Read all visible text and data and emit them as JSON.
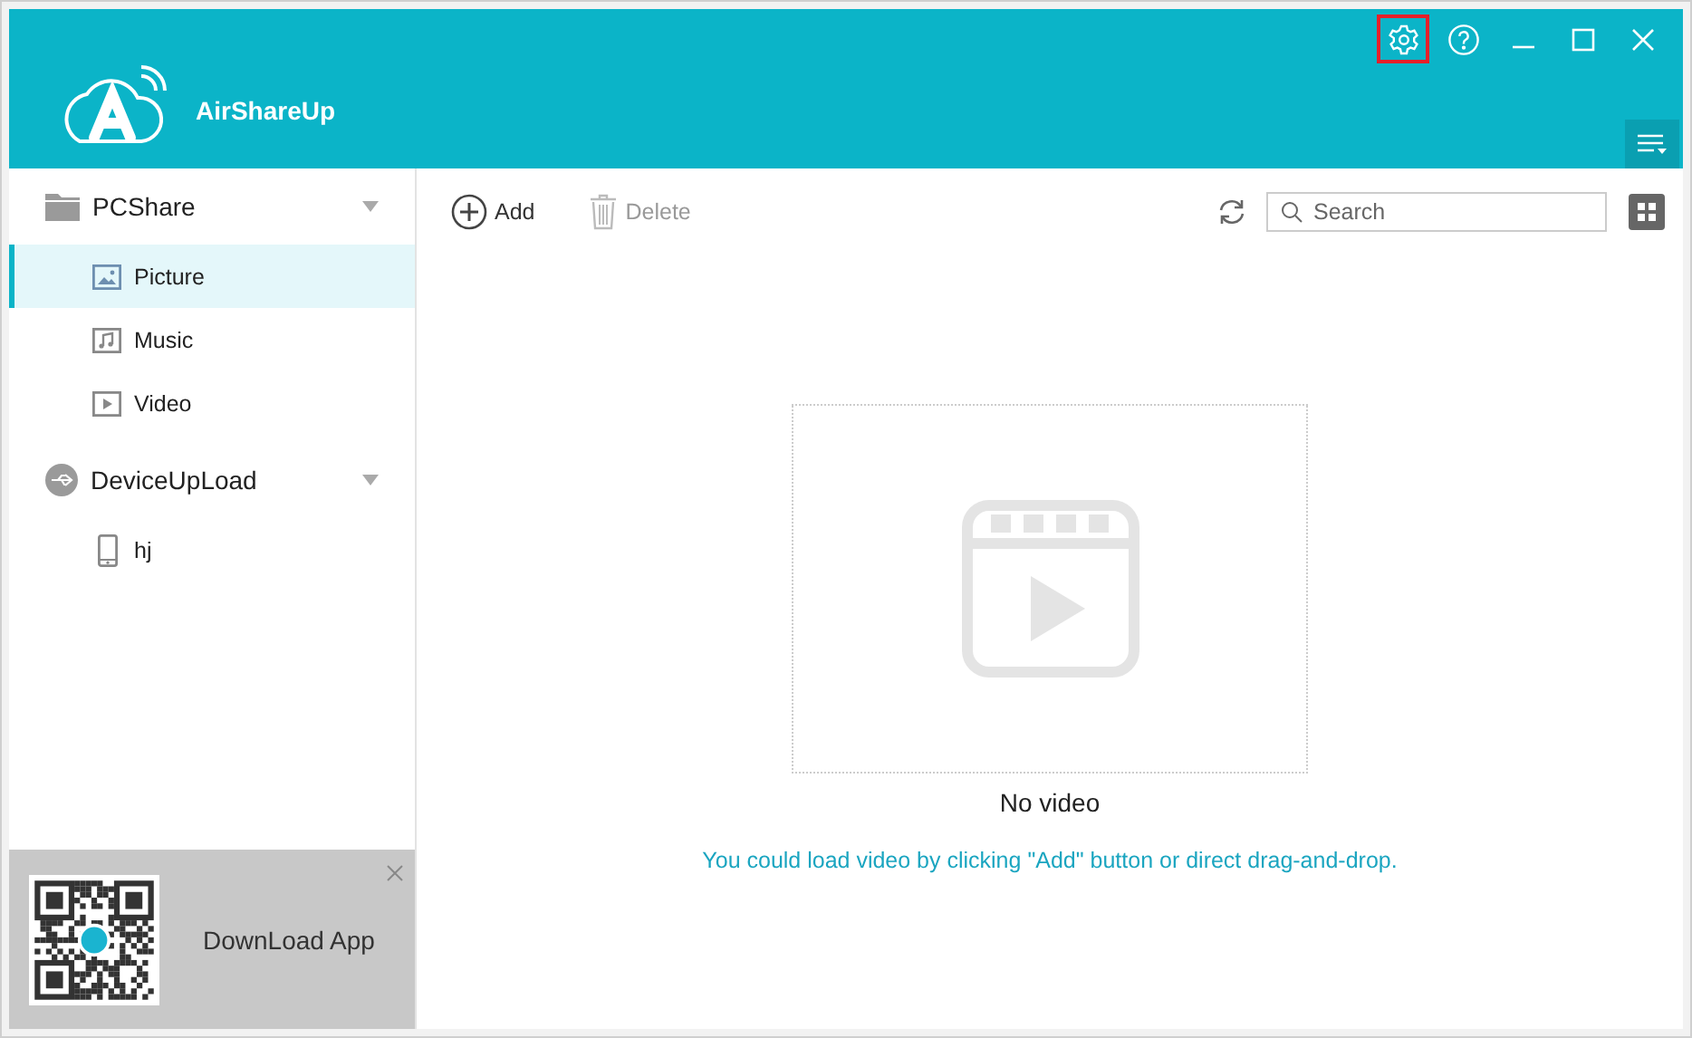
{
  "app": {
    "name": "AirShareUp"
  },
  "title_buttons": [
    {
      "kind": "settings",
      "highlighted": true
    },
    {
      "kind": "help",
      "highlighted": false
    },
    {
      "kind": "minimize",
      "highlighted": false
    },
    {
      "kind": "maximize",
      "highlighted": false
    },
    {
      "kind": "close",
      "highlighted": false
    }
  ],
  "sidebar": {
    "groups": [
      {
        "label": "PCShare",
        "kind": "folder",
        "children": [
          {
            "label": "Picture",
            "kind": "picture",
            "selected": true
          },
          {
            "label": "Music",
            "kind": "music",
            "selected": false
          },
          {
            "label": "Video",
            "kind": "video",
            "selected": false
          }
        ]
      },
      {
        "label": "DeviceUpLoad",
        "kind": "usb",
        "children": [
          {
            "label": "hj",
            "kind": "phone",
            "selected": false
          }
        ]
      }
    ]
  },
  "promo": {
    "text": "DownLoad App"
  },
  "toolbar": {
    "buttons": [
      {
        "kind": "add",
        "label": "Add",
        "disabled": false
      },
      {
        "kind": "delete",
        "label": "Delete",
        "disabled": true
      }
    ],
    "search": {
      "placeholder": "Search"
    }
  },
  "empty_state": {
    "title": "No video",
    "hint": "You could load video by clicking \"Add\" button or direct drag-and-drop."
  }
}
